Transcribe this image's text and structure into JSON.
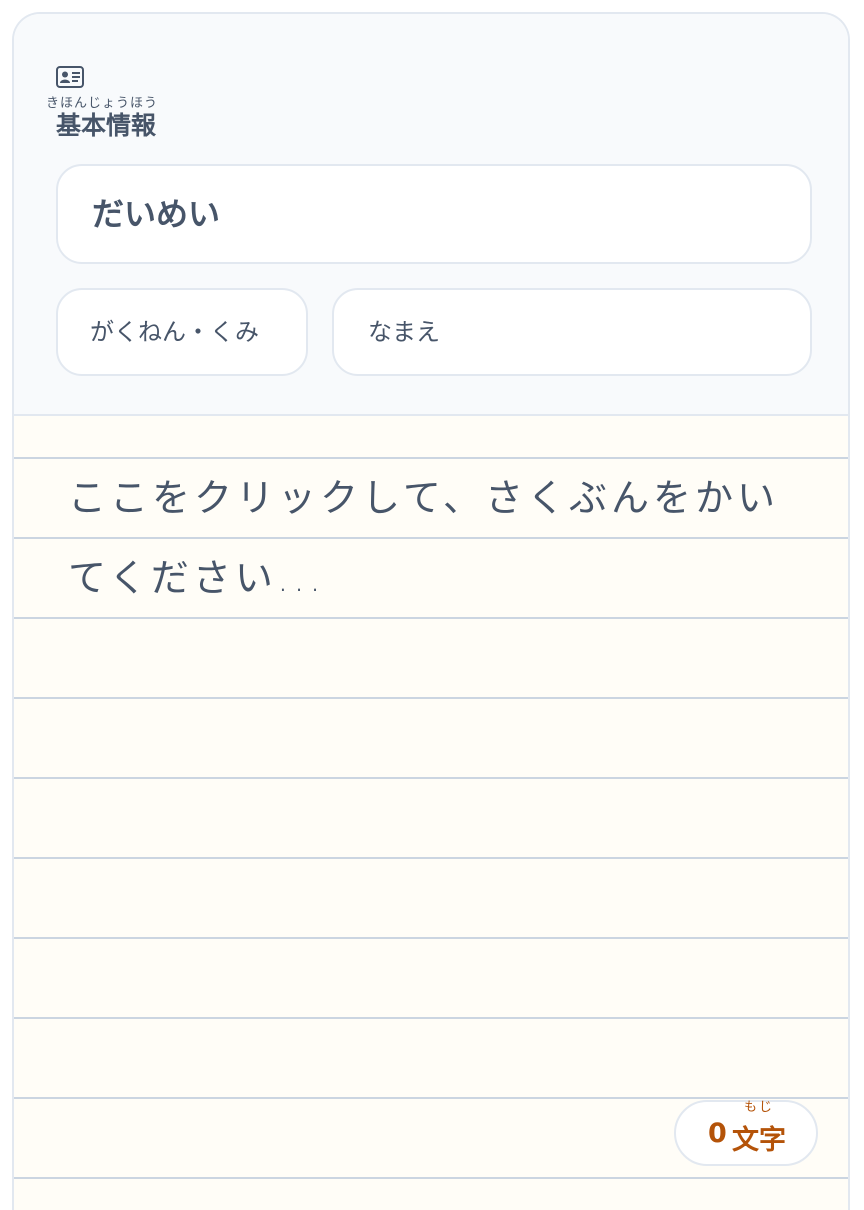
{
  "section": {
    "icon": "id-card-icon",
    "title": "基本情報",
    "title_ruby": "きほんじょうほう"
  },
  "form": {
    "title_placeholder": "だいめい",
    "grade_placeholder": "がくねん・くみ",
    "name_placeholder": "なまえ"
  },
  "essay": {
    "placeholder": "ここをクリックして、さくぶんをかいてください..."
  },
  "counter": {
    "value": "0",
    "unit": "文字",
    "unit_ruby": "もじ"
  },
  "colors": {
    "header_bg": "#f8fafc",
    "paper_bg": "#fffdf7",
    "border": "#e2e8f0",
    "line": "#cbd5e1",
    "text": "#475569",
    "accent": "#b45309"
  }
}
